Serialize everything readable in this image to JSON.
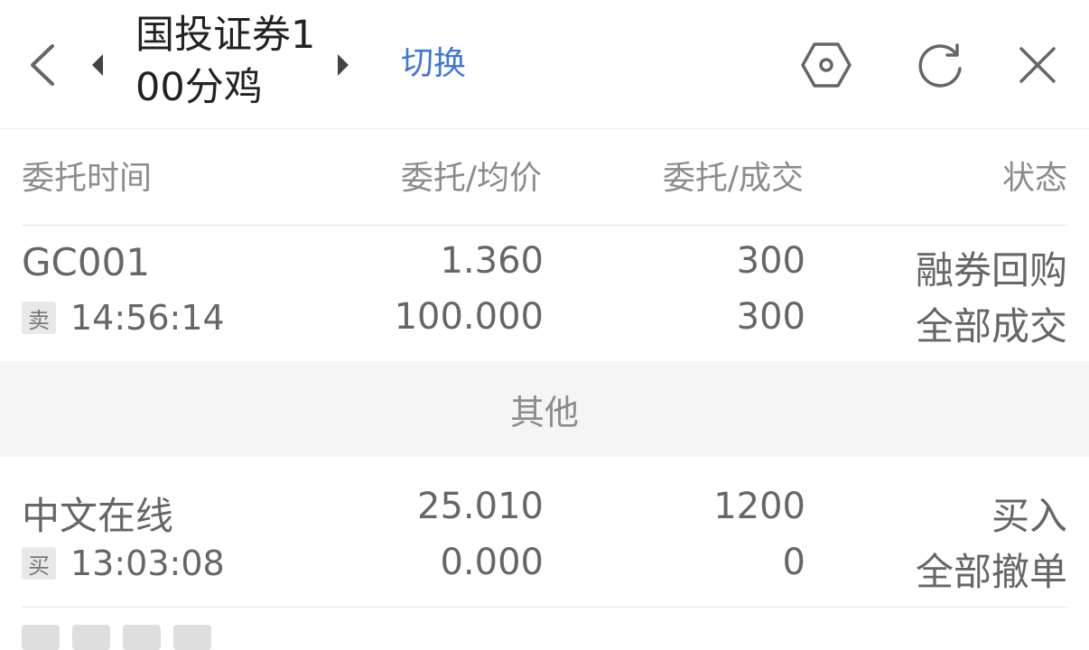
{
  "header": {
    "account_title": "国投证券100分鸡",
    "switch_label": "切换",
    "icons": {
      "back": "chevron-left-icon",
      "prev": "caret-left-icon",
      "next": "caret-right-icon",
      "settings": "hexagon-settings-icon",
      "refresh": "refresh-icon",
      "close": "close-icon"
    }
  },
  "columns": {
    "time": "委托时间",
    "price": "委托/均价",
    "qty": "委托/成交",
    "status": "状态"
  },
  "orders": [
    {
      "name": "GC001",
      "side": "卖",
      "time": "14:56:14",
      "order_price": "1.360",
      "avg_price": "100.000",
      "order_qty": "300",
      "filled_qty": "300",
      "type": "融券回购",
      "status": "全部成交"
    }
  ],
  "section": {
    "title": "其他"
  },
  "other_orders": [
    {
      "name": "中文在线",
      "side": "买",
      "time": "13:03:08",
      "order_price": "25.010",
      "avg_price": "0.000",
      "order_qty": "1200",
      "filled_qty": "0",
      "type": "买入",
      "status": "全部撤单"
    }
  ],
  "colors": {
    "accent": "#3d78d6",
    "text_primary": "#222222",
    "text_secondary": "#666666",
    "text_muted": "#8c8c8c",
    "band": "#f5f5f5"
  }
}
